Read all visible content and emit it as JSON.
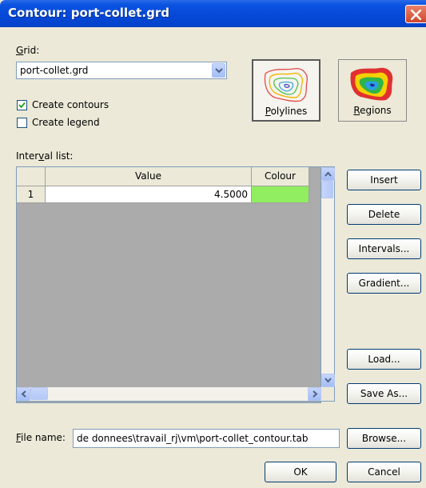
{
  "window": {
    "title": "Contour: port-collet.grd"
  },
  "grid_section": {
    "label": "Grid:",
    "selected": "port-collet.grd"
  },
  "options": {
    "create_contours": {
      "label": "Create contours",
      "checked": true
    },
    "create_legend": {
      "label": "Create legend",
      "checked": false
    }
  },
  "type_buttons": {
    "polylines": "Polylines",
    "regions": "Regions",
    "selected": "polylines"
  },
  "interval_list": {
    "label": "Interval list:",
    "columns": [
      "",
      "Value",
      "Colour"
    ],
    "rows": [
      {
        "index": "1",
        "value": "4.5000",
        "colour": "#90ee60"
      }
    ]
  },
  "side_buttons": {
    "insert": "Insert",
    "delete": "Delete",
    "intervals": "Intervals...",
    "gradient": "Gradient...",
    "load": "Load...",
    "save_as": "Save As..."
  },
  "file": {
    "label": "File name:",
    "value": "de donnees\\travail_rj\\vm\\port-collet_contour.tab",
    "browse": "Browse..."
  },
  "footer": {
    "ok": "OK",
    "cancel": "Cancel"
  },
  "colors": {
    "titlebar": "#0548d6",
    "dialog_bg": "#ece9d8",
    "grid_bg": "#ababab"
  }
}
